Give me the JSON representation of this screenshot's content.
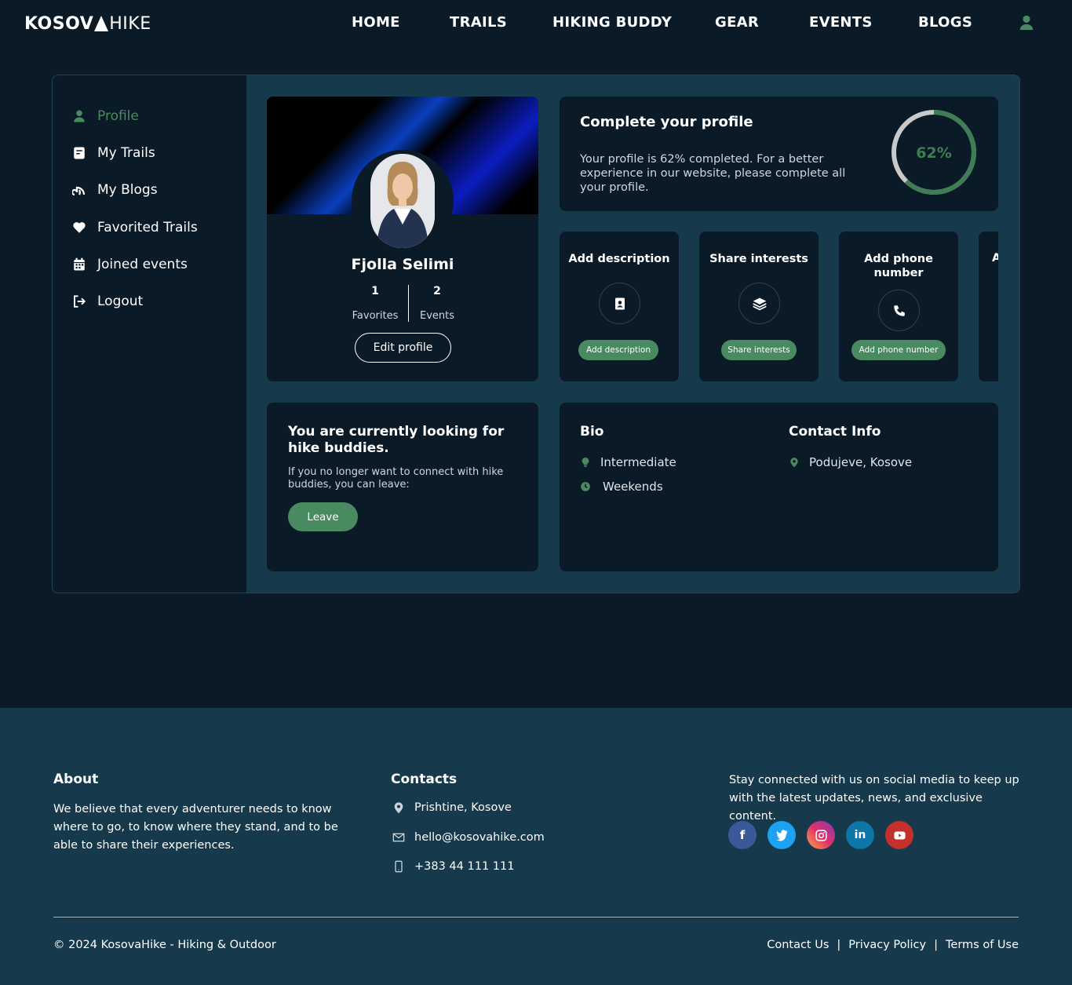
{
  "brand": {
    "logo_bold": "KOSOV",
    "logo_light": "HIKE"
  },
  "nav": {
    "home": "HOME",
    "trails": "TRAILS",
    "hiking_buddy": "HIKING BUDDY",
    "gear": "GEAR",
    "events": "EVENTS",
    "blogs": "BLOGS"
  },
  "sidebar": {
    "items": [
      {
        "label": "Profile",
        "icon": "user-icon"
      },
      {
        "label": "My Trails",
        "icon": "list-icon"
      },
      {
        "label": "My Blogs",
        "icon": "blog-icon"
      },
      {
        "label": "Favorited Trails",
        "icon": "heart-icon"
      },
      {
        "label": "Joined events",
        "icon": "calendar-icon"
      },
      {
        "label": "Logout",
        "icon": "logout-icon"
      }
    ]
  },
  "profile": {
    "name": "Fjolla Selimi",
    "favorites_count": "1",
    "favorites_label": "Favorites",
    "events_count": "2",
    "events_label": "Events",
    "edit_button": "Edit profile"
  },
  "completion": {
    "title": "Complete your profile",
    "text": "Your profile is 62% completed. For a better experience in our website, please complete all your profile.",
    "percent_label": "62%",
    "percent": 62
  },
  "tasks": [
    {
      "title": "Add description",
      "button": "Add description",
      "icon": "contact-card-icon"
    },
    {
      "title": "Share interests",
      "button": "Share interests",
      "icon": "layers-icon"
    },
    {
      "title": "Add phone number",
      "button": "Add phone number",
      "icon": "phone-icon"
    },
    {
      "title": "A",
      "button": "",
      "icon": ""
    }
  ],
  "buddy": {
    "title": "You are currently looking for hike buddies.",
    "text": "If you no longer want to connect with hike buddies, you can leave:",
    "leave_button": "Leave"
  },
  "bio": {
    "title": "Bio",
    "level": "Intermediate",
    "availability": "Weekends"
  },
  "contact_info": {
    "title": "Contact Info",
    "location": "Podujeve, Kosove"
  },
  "footer": {
    "about_title": "About",
    "about_text": "We believe that every adventurer needs to know where to go, to know where they stand, and to be able to share their experiences.",
    "contacts_title": "Contacts",
    "address": "Prishtine, Kosove",
    "email": "hello@kosovahike.com",
    "phone": "+383 44 111 111",
    "social_text": "Stay connected with us on social media to keep up with the latest updates, news, and exclusive content.",
    "copyright": "© 2024 KosovaHike - Hiking & Outdoor",
    "links": {
      "contact": "Contact Us",
      "privacy": "Privacy Policy",
      "terms": "Terms of Use",
      "separator": "|"
    }
  },
  "colors": {
    "accent": "#4a8a61",
    "background": "#0b1a27",
    "panel": "#16394b"
  }
}
